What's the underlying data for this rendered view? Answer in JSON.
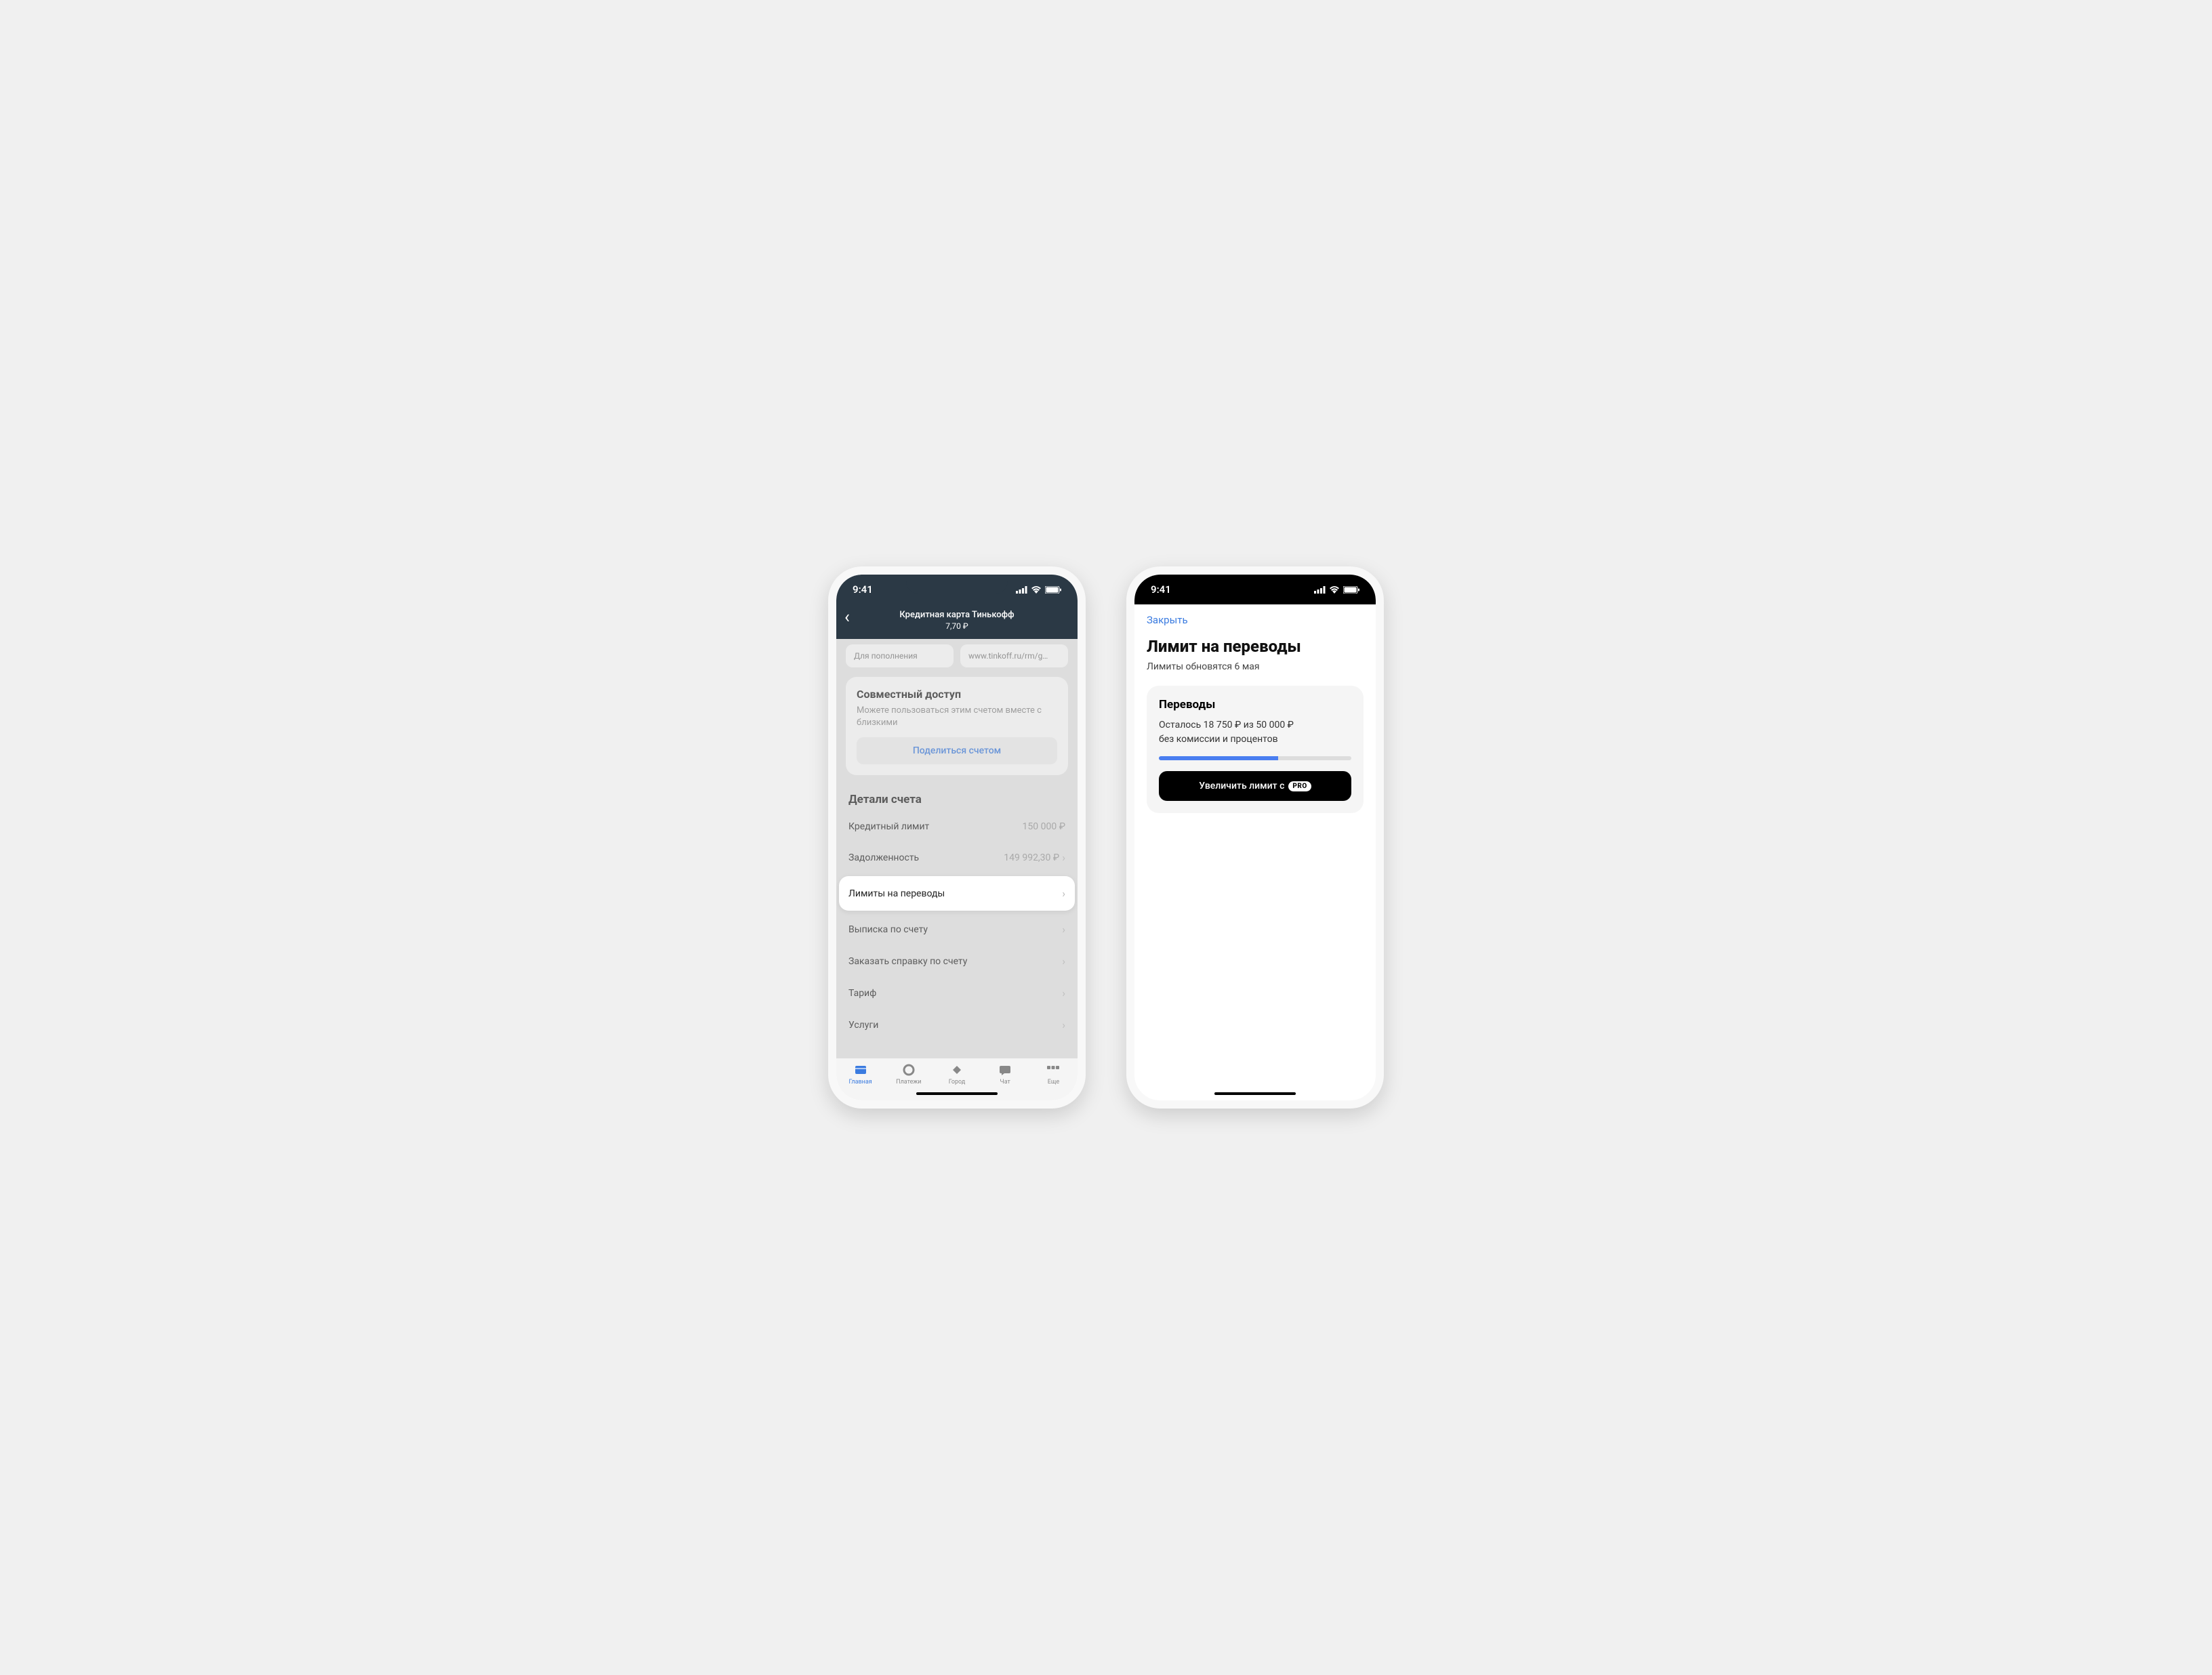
{
  "status": {
    "time": "9:41"
  },
  "phone1": {
    "header": {
      "title": "Кредитная карта Тинькофф",
      "balance": "7,70 ₽"
    },
    "chips": {
      "left": "Для пополнения",
      "right": "www.tinkoff.ru/rm/g…"
    },
    "shared": {
      "title": "Совместный доступ",
      "desc": "Можете пользоваться этим счетом вместе с близкими",
      "button": "Поделиться счетом"
    },
    "details": {
      "title": "Детали счета",
      "rows": [
        {
          "label": "Кредитный лимит",
          "value": "150 000 ₽"
        },
        {
          "label": "Задолженность",
          "value": "149 992,30 ₽"
        },
        {
          "label": "Лимиты на переводы",
          "value": ""
        },
        {
          "label": "Выписка по счету",
          "value": ""
        },
        {
          "label": "Заказать справку по счету",
          "value": ""
        },
        {
          "label": "Тариф",
          "value": ""
        },
        {
          "label": "Услуги",
          "value": ""
        }
      ]
    },
    "tabs": [
      {
        "label": "Главная"
      },
      {
        "label": "Платежи"
      },
      {
        "label": "Город"
      },
      {
        "label": "Чат"
      },
      {
        "label": "Еще"
      }
    ]
  },
  "phone2": {
    "close": "Закрыть",
    "title": "Лимит на переводы",
    "subtitle": "Лимиты обновятся 6 мая",
    "card": {
      "title": "Переводы",
      "line1": "Осталось 18 750 ₽ из 50 000 ₽",
      "line2": "без комиссии и процентов",
      "button": "Увеличить лимит с",
      "pro": "PRO"
    }
  }
}
